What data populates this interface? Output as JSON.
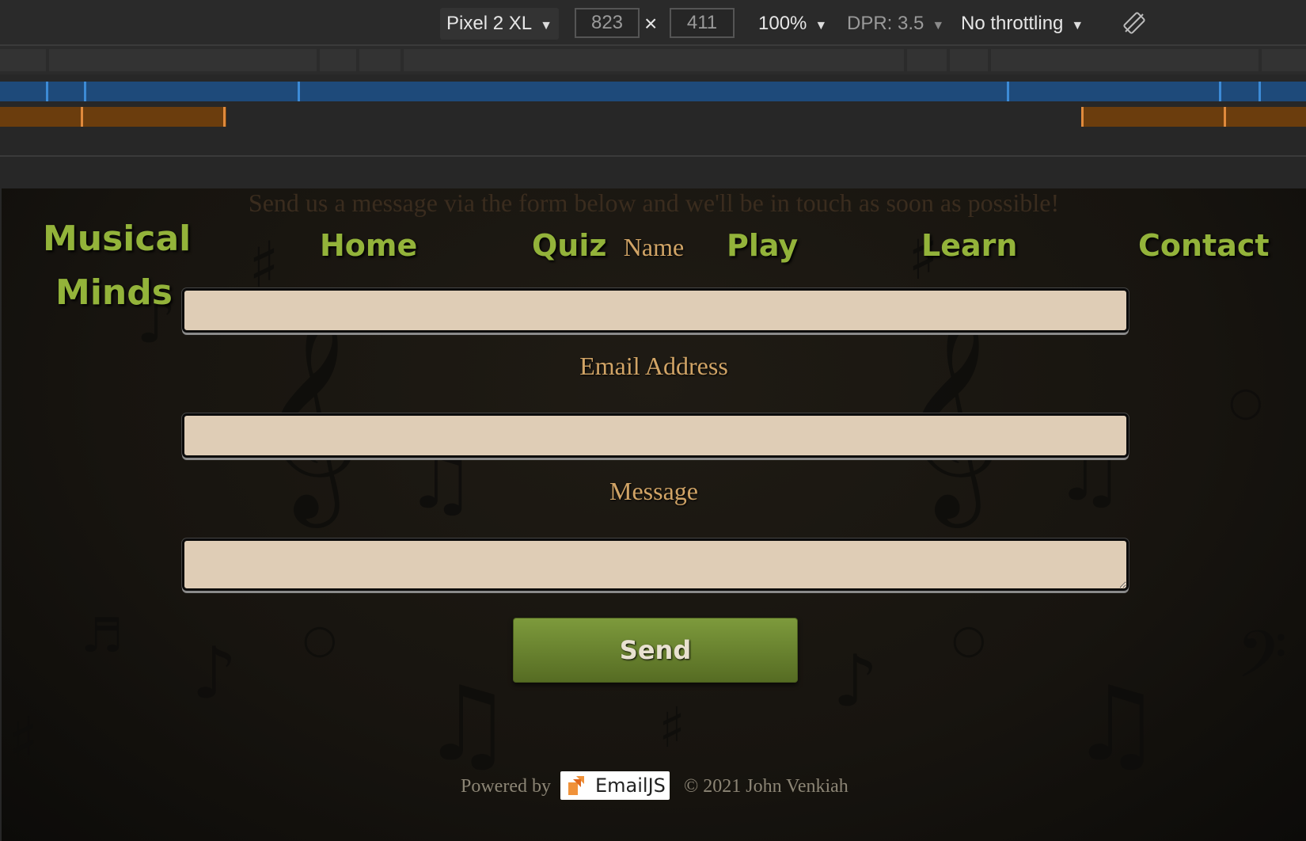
{
  "devtools": {
    "device": "Pixel 2 XL",
    "width": "823",
    "height": "411",
    "times": "×",
    "zoom": "100%",
    "dpr": "DPR: 3.5",
    "throttling": "No throttling",
    "caret": "▼"
  },
  "page": {
    "intro": "Send us a message via the form below and we'll be in touch as soon as possible!",
    "logo": {
      "line1": "Musical",
      "line2": "Minds"
    },
    "nav": {
      "home": "Home",
      "quiz": "Quiz",
      "play": "Play",
      "learn": "Learn",
      "contact": "Contact"
    },
    "form": {
      "name_label": "Name",
      "email_label": "Email Address",
      "message_label": "Message",
      "name_value": "",
      "email_value": "",
      "message_value": "",
      "send_label": "Send"
    },
    "footer": {
      "powered_by": "Powered by",
      "emailjs": "EmailJS",
      "copyright": "© 2021 John Venkiah"
    }
  },
  "colors": {
    "accent_green": "#93b33a",
    "label_gold": "#d1a466",
    "field_bg": "#dfcdb6"
  }
}
